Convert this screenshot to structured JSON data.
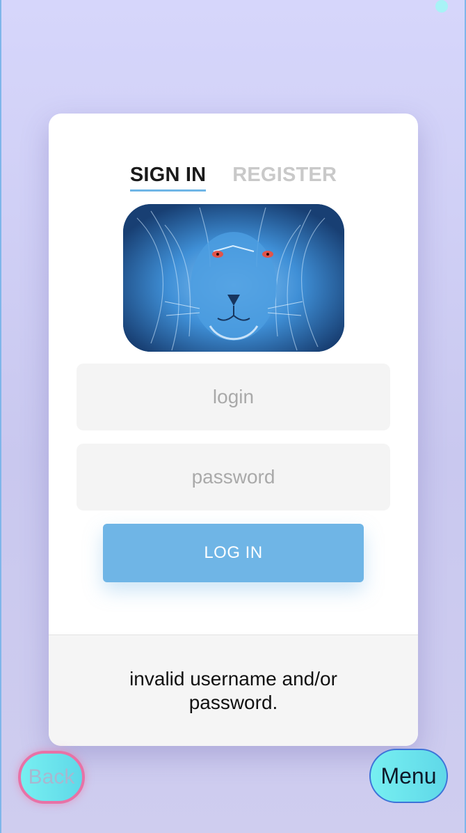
{
  "tabs": {
    "sign_in": "SIGN IN",
    "register": "REGISTER"
  },
  "hero": {
    "icon": "lion-image",
    "alt": "lion"
  },
  "form": {
    "login_placeholder": "login",
    "password_placeholder": "password",
    "login_value": "",
    "password_value": "",
    "submit_label": "LOG IN"
  },
  "status": {
    "error_message": "invalid username and/or password."
  },
  "nav": {
    "back_label": "Back",
    "menu_label": "Menu"
  },
  "colors": {
    "accent": "#6fb5e6",
    "background": "#d6d6fb",
    "back_border": "#e872a6",
    "menu_border": "#3d73d8",
    "button_fill": "#77eff1"
  }
}
